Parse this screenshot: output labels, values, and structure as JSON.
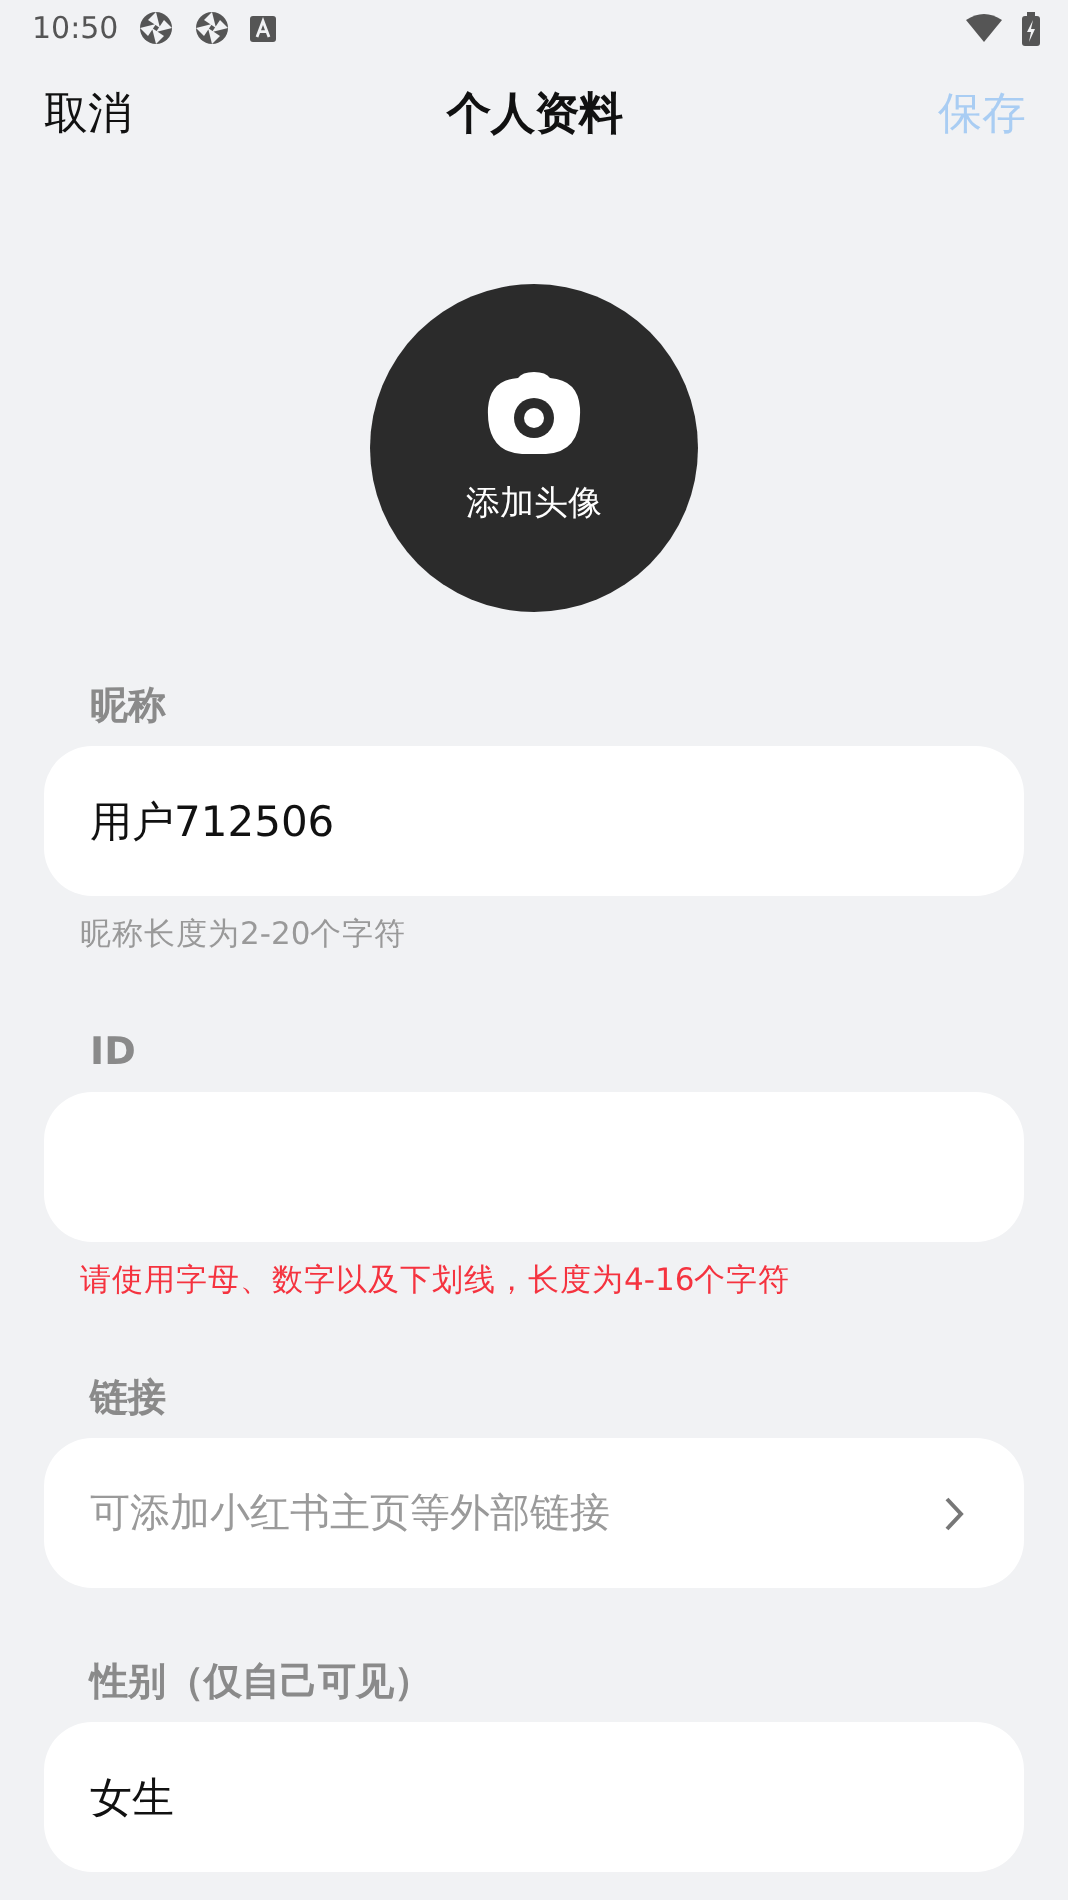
{
  "status_bar": {
    "time": "10:50"
  },
  "header": {
    "cancel": "取消",
    "title": "个人资料",
    "save": {
      "label": "保存",
      "disabled": true
    }
  },
  "avatar": {
    "label": "添加头像"
  },
  "fields": [
    {
      "kind": "text",
      "label": "昵称",
      "value": "用户712506",
      "hint": {
        "text": "昵称长度为2-20个字符",
        "kind": "info"
      }
    },
    {
      "kind": "text",
      "label": "ID",
      "hint": {
        "text": "请使用字母、数字以及下划线，长度为4-16个字符",
        "kind": "error"
      }
    },
    {
      "kind": "link",
      "label": "链接",
      "placeholder": "可添加小红书主页等外部链接"
    },
    {
      "kind": "text",
      "label": "性别（仅自己可见）",
      "value": "女生"
    }
  ]
}
